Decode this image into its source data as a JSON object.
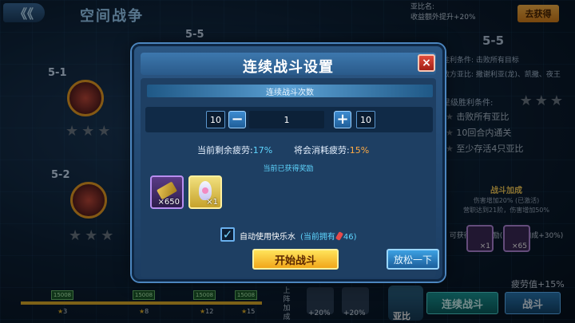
{
  "scene": {
    "title": "空间战争",
    "back_label": "《《",
    "top_info_line1": "亚比名:",
    "top_info_line2": "收益额外提升+20%",
    "get_button": "去获得"
  },
  "stages": [
    {
      "label": "5-1"
    },
    {
      "label": "5-2"
    },
    {
      "label": "5-5"
    }
  ],
  "right_panel": {
    "stage": "5-5",
    "line1": "胜利条件: 击败所有目标",
    "line2": "敌方亚比: 撒谢利亚(龙)、凯撒、夜王",
    "conditions_title": "星级胜利条件:",
    "conditions": [
      "击败所有亚比",
      "10回合内通关",
      "至少存活4只亚比"
    ],
    "bonus_title": "战斗加成",
    "bonus_line1": "伤害增加20% (已激活)",
    "bonus_line2": "营职达到21阶，伤害增加50%",
    "earn_text": "可获得以下奖励(已获得加成+30%)",
    "item_qty_1": "×1",
    "item_qty_2": "×65",
    "fatigue_bonus": "疲劳值+15%"
  },
  "bottom": {
    "progress_badges": [
      "15008",
      "15008",
      "15008",
      "15008"
    ],
    "progress_marks": [
      "3",
      "8",
      "12",
      "15"
    ],
    "bonus_vertical": "上阵加成",
    "pet_pcts": [
      "+20%",
      "+20%"
    ],
    "hero_name": "亚比",
    "continuous_button": "连续战斗",
    "fight_button": "战斗"
  },
  "modal": {
    "title": "连续战斗设置",
    "close_icon": "×",
    "section_label": "连续战斗次数",
    "min_value": "10",
    "max_value": "10",
    "count_value": "1",
    "minus_label": "−",
    "plus_label": "+",
    "fatigue_current_label": "当前剩余疲劳:",
    "fatigue_current_value": "17%",
    "fatigue_cost_label": "将会消耗疲劳:",
    "fatigue_cost_value": "15%",
    "earned_label": "当前已获得奖励",
    "rewards": [
      {
        "qty": "×650",
        "icon": "ticket-icon"
      },
      {
        "qty": "×1",
        "icon": "crystal-icon"
      }
    ],
    "auto_checked": "✓",
    "auto_label": "自动使用快乐水",
    "auto_note_prefix": "(当前拥有",
    "auto_note_count": "46)",
    "start_button": "开始战斗",
    "relax_button": "放松一下"
  }
}
